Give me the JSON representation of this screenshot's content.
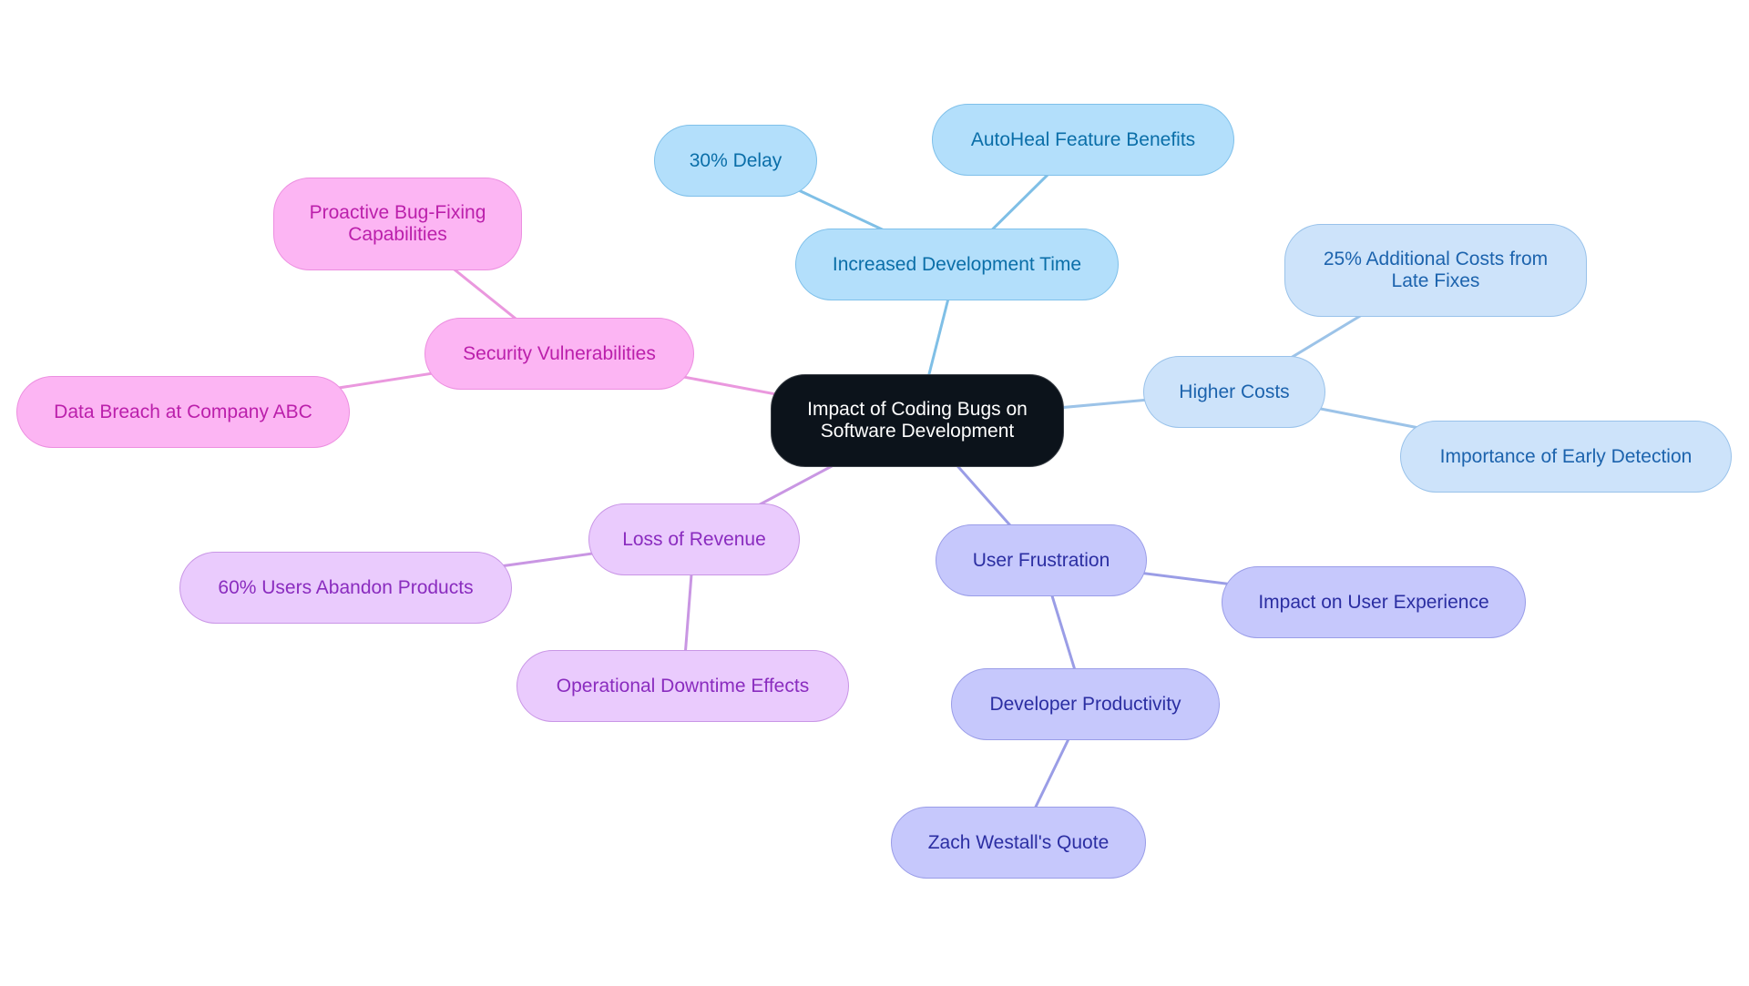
{
  "diagram": {
    "type": "mind-map",
    "root": {
      "id": "root",
      "label": "Impact of Coding Bugs on Software Development"
    },
    "branches": [
      {
        "id": "idt",
        "label": "Increased Development Time",
        "color_class": "c-blue",
        "edge_color": "#7fbfe6",
        "children": [
          {
            "id": "delay",
            "label": "30% Delay"
          },
          {
            "id": "autoheal",
            "label": "AutoHeal Feature Benefits"
          }
        ]
      },
      {
        "id": "hc",
        "label": "Higher Costs",
        "color_class": "c-lblue",
        "edge_color": "#9cc3e8",
        "children": [
          {
            "id": "late",
            "label": "25% Additional Costs from Late Fixes"
          },
          {
            "id": "early",
            "label": "Importance of Early Detection"
          }
        ]
      },
      {
        "id": "uf",
        "label": "User Frustration",
        "color_class": "c-indigo",
        "edge_color": "#9a9de6",
        "children": [
          {
            "id": "ux",
            "label": "Impact on User Experience"
          },
          {
            "id": "dp",
            "label": "Developer Productivity",
            "children": [
              {
                "id": "zach",
                "label": "Zach Westall's Quote"
              }
            ]
          }
        ]
      },
      {
        "id": "lor",
        "label": "Loss of Revenue",
        "color_class": "c-violet",
        "edge_color": "#c996e3",
        "children": [
          {
            "id": "abandon",
            "label": "60% Users Abandon Products"
          },
          {
            "id": "downtime",
            "label": "Operational Downtime Effects"
          }
        ]
      },
      {
        "id": "sv",
        "label": "Security Vulnerabilities",
        "color_class": "c-pink",
        "edge_color": "#ea98de",
        "children": [
          {
            "id": "proactive",
            "label": "Proactive Bug-Fixing Capabilities"
          },
          {
            "id": "breach",
            "label": "Data Breach at Company ABC"
          }
        ]
      }
    ]
  }
}
